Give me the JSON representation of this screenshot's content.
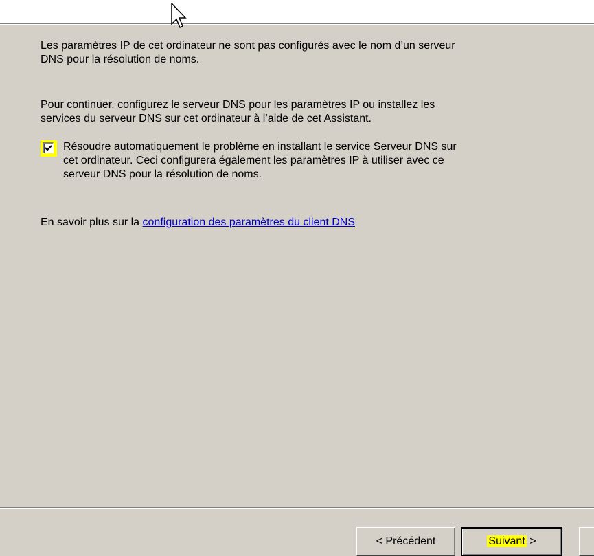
{
  "wizard": {
    "paragraph1_line1": "Les paramètres IP de cet ordinateur ne sont pas configurés avec le nom d’un serveur",
    "paragraph1_line2": "DNS pour la résolution de noms.",
    "paragraph2_line1": "Pour continuer, configurez le serveur DNS pour les paramètres IP ou installez les",
    "paragraph2_line2": "services du serveur DNS sur cet ordinateur à l’aide de cet Assistant.",
    "checkbox": {
      "checked": true,
      "line1": "Résoudre automatiquement le problème en installant le service Serveur DNS sur",
      "line2": "cet ordinateur. Ceci configurera également les paramètres IP à utiliser avec ce",
      "line3": "serveur DNS pour la résolution de noms."
    },
    "learn_more_prefix": "En savoir plus sur la ",
    "learn_more_link": "configuration des paramètres du client DNS"
  },
  "buttons": {
    "previous": "< Précédent",
    "next_label": "Suivant",
    "next_suffix": " >"
  },
  "icons": {
    "cursor": "mouse-pointer-icon",
    "check": "checkmark-icon"
  },
  "colors": {
    "dialog_bg": "#d4d0c8",
    "highlight": "#ffff00",
    "link": "#0000cc"
  }
}
